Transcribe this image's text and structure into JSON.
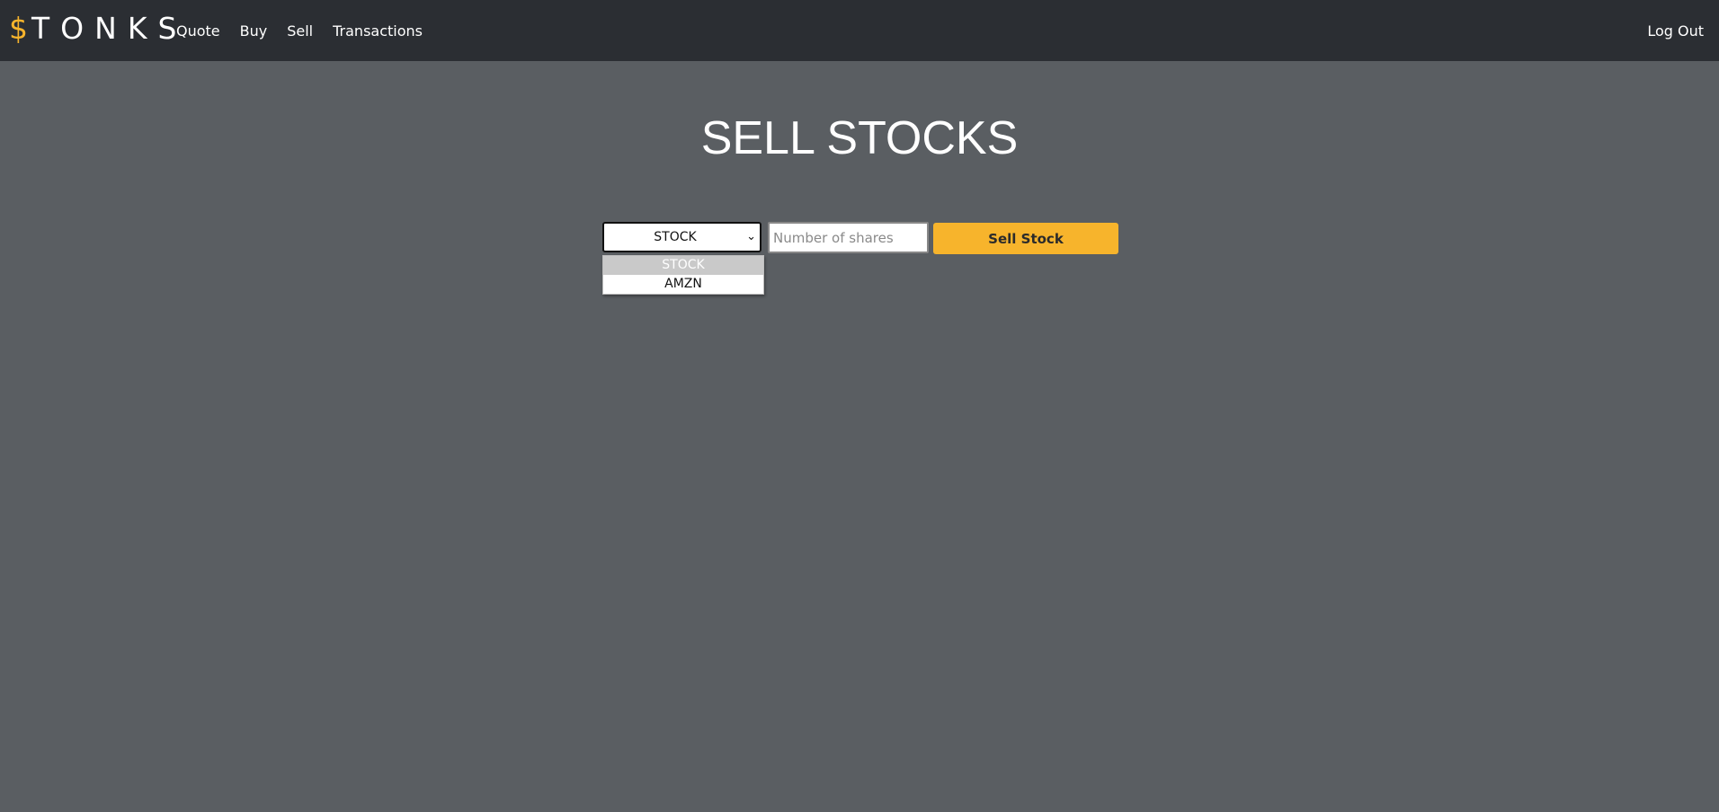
{
  "navbar": {
    "brand_symbol": "$",
    "brand_text": "TONKS",
    "links": [
      {
        "label": "Quote"
      },
      {
        "label": "Buy"
      },
      {
        "label": "Sell"
      },
      {
        "label": "Transactions"
      }
    ],
    "logout_label": "Log Out"
  },
  "page": {
    "title": "SELL STOCKS"
  },
  "form": {
    "stock_select": {
      "selected": "STOCK",
      "options": [
        "STOCK",
        "AMZN"
      ]
    },
    "shares_input": {
      "value": "",
      "placeholder": "Number of shares"
    },
    "submit_label": "Sell Stock"
  },
  "colors": {
    "accent": "#f7b42c",
    "navbar_bg": "#2b2e33",
    "page_bg": "#5a5e62"
  }
}
